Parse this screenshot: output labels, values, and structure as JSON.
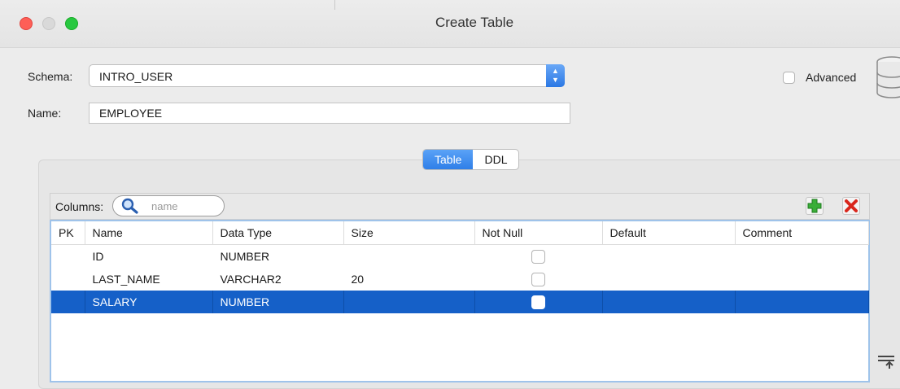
{
  "window": {
    "title": "Create Table"
  },
  "form": {
    "schema_label": "Schema:",
    "schema_value": "INTRO_USER",
    "name_label": "Name:",
    "name_value": "EMPLOYEE",
    "advanced_label": "Advanced",
    "advanced_checked": false
  },
  "tabs": [
    {
      "label": "Table",
      "active": true
    },
    {
      "label": "DDL",
      "active": false
    }
  ],
  "columns_panel": {
    "label": "Columns:",
    "search_placeholder": "name"
  },
  "table": {
    "headers": [
      "PK",
      "Name",
      "Data Type",
      "Size",
      "Not Null",
      "Default",
      "Comment"
    ],
    "rows": [
      {
        "pk": "",
        "name": "ID",
        "type": "NUMBER",
        "size": "",
        "not_null": false,
        "default": "",
        "comment": "",
        "selected": false
      },
      {
        "pk": "",
        "name": "LAST_NAME",
        "type": "VARCHAR2",
        "size": "20",
        "not_null": false,
        "default": "",
        "comment": "",
        "selected": false
      },
      {
        "pk": "",
        "name": "SALARY",
        "type": "NUMBER",
        "size": "",
        "not_null": false,
        "default": "",
        "comment": "",
        "selected": true
      }
    ]
  },
  "colors": {
    "selection": "#1560c8",
    "tab_active": "#2f7fe8",
    "add_icon": "#2e9e2e",
    "delete_icon": "#d9261c"
  },
  "icons": [
    "search-icon",
    "add-column-icon",
    "delete-column-icon",
    "database-icon",
    "sort-icon"
  ]
}
